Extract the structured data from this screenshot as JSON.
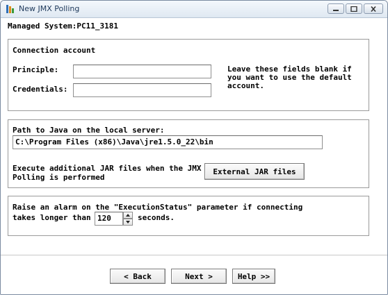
{
  "window": {
    "title": "New JMX Polling"
  },
  "managed_system": "Managed System:PC11_3181",
  "connection": {
    "heading": "Connection account",
    "principle_label": "Principle:",
    "principle_value": "",
    "credentials_label": "Credentials:",
    "credentials_value": "",
    "hint_line1": "Leave these fields blank if",
    "hint_line2": "you want to use the default",
    "hint_line3": "account."
  },
  "java": {
    "path_label": "Path to Java on the local server:",
    "path_value": "C:\\Program Files (x86)\\Java\\jre1.5.0_22\\bin",
    "jar_text_line1": "Execute additional JAR files when the JMX",
    "jar_text_line2": "Polling is performed",
    "jar_button": "External JAR files"
  },
  "alarm": {
    "line1": "Raise an alarm on the \"ExecutionStatus\" parameter if connecting",
    "prefix": "takes longer than",
    "value": "120",
    "suffix": "seconds."
  },
  "footer": {
    "back": "< Back",
    "next": "Next >",
    "help": "Help >>"
  }
}
